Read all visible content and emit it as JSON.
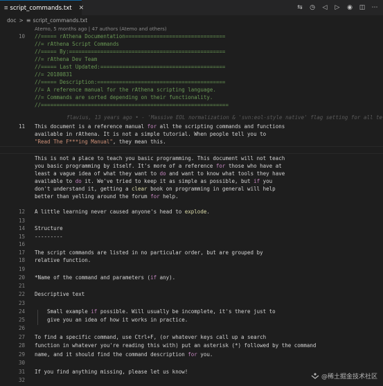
{
  "tab": {
    "icon": "list-lines-icon",
    "filename": "script_commands.txt"
  },
  "toolbar": {
    "icons": [
      "compare-changes-icon",
      "open-timeline-icon",
      "previous-change-icon",
      "next-change-icon",
      "circle-dot-icon",
      "split-editor-icon",
      "more-actions-icon"
    ]
  },
  "breadcrumb": {
    "folder": "doc",
    "separator": ">",
    "file_icon": "list-lines-icon",
    "file": "script_commands.txt"
  },
  "codelens": {
    "text": "Atemo, 5 months ago | 47 authors (Atemo and others)"
  },
  "inline_blame": {
    "text": "flavius, 13 years ago • - 'Massive EOL normalization & 'svn:eol-style native' flag setting for all te"
  },
  "lines": [
    {
      "n": "10",
      "segs": [
        {
          "t": "//===== rAthena Documentation================================",
          "c": "cmt"
        }
      ]
    },
    {
      "n": "",
      "segs": [
        {
          "t": "//= rAthena Script Commands",
          "c": "cmt"
        }
      ]
    },
    {
      "n": "",
      "segs": [
        {
          "t": "//===== By:==================================================",
          "c": "cmt"
        }
      ]
    },
    {
      "n": "",
      "segs": [
        {
          "t": "//= rAthena Dev Team",
          "c": "cmt"
        }
      ]
    },
    {
      "n": "",
      "segs": [
        {
          "t": "//===== Last Updated:========================================",
          "c": "cmt"
        }
      ]
    },
    {
      "n": "",
      "segs": [
        {
          "t": "//= 20180831",
          "c": "cmt"
        }
      ]
    },
    {
      "n": "",
      "segs": [
        {
          "t": "//===== Description:=========================================",
          "c": "cmt"
        }
      ]
    },
    {
      "n": "",
      "segs": [
        {
          "t": "//= A reference manual for the rAthena scripting language.",
          "c": "cmt"
        }
      ]
    },
    {
      "n": "",
      "segs": [
        {
          "t": "//= Commands are sorted depending on their functionality.",
          "c": "cmt"
        }
      ]
    },
    {
      "n": "",
      "segs": [
        {
          "t": "//============================================================",
          "c": "cmt"
        }
      ]
    },
    {
      "n": "",
      "blame": true,
      "segs": []
    },
    {
      "n": "11",
      "active": true,
      "segs": [
        {
          "t": "This document is a reference manual ",
          "c": ""
        },
        {
          "t": "for",
          "c": "ctl"
        },
        {
          "t": " all the scripting commands and functions",
          "c": ""
        }
      ]
    },
    {
      "n": "",
      "segs": [
        {
          "t": "available in rAthena. It is not a simple tutorial. When people tell you to",
          "c": ""
        }
      ]
    },
    {
      "n": "",
      "segs": [
        {
          "t": "\"Read The F***ing Manual\"",
          "c": "str"
        },
        {
          "t": ", they mean this.",
          "c": ""
        }
      ]
    },
    {
      "n": "",
      "segs": []
    },
    {
      "n": "",
      "segs": [
        {
          "t": "This is not a place to teach you basic programming. This document will not teach",
          "c": ""
        }
      ]
    },
    {
      "n": "",
      "segs": [
        {
          "t": "you basic programming by itself. It's more of a reference ",
          "c": ""
        },
        {
          "t": "for",
          "c": "ctl"
        },
        {
          "t": " those who have at",
          "c": ""
        }
      ]
    },
    {
      "n": "",
      "segs": [
        {
          "t": "least a vague idea of what they want to ",
          "c": ""
        },
        {
          "t": "do",
          "c": "ctl"
        },
        {
          "t": " and want to know what tools they have",
          "c": ""
        }
      ]
    },
    {
      "n": "",
      "segs": [
        {
          "t": "available to ",
          "c": ""
        },
        {
          "t": "do",
          "c": "ctl"
        },
        {
          "t": " it. We've tried to keep it as simple as possible, but ",
          "c": ""
        },
        {
          "t": "if",
          "c": "ctl"
        },
        {
          "t": " you",
          "c": ""
        }
      ]
    },
    {
      "n": "",
      "segs": [
        {
          "t": "don't understand it, getting a ",
          "c": ""
        },
        {
          "t": "clear",
          "c": "fn"
        },
        {
          "t": " book on programming in general will help",
          "c": ""
        }
      ]
    },
    {
      "n": "",
      "segs": [
        {
          "t": "better than yelling around the forum ",
          "c": ""
        },
        {
          "t": "for",
          "c": "ctl"
        },
        {
          "t": " help.",
          "c": ""
        }
      ]
    },
    {
      "n": "",
      "segs": []
    },
    {
      "n": "12",
      "segs": [
        {
          "t": "A little learning never caused anyone's head to ",
          "c": ""
        },
        {
          "t": "explode",
          "c": "fn"
        },
        {
          "t": ".",
          "c": ""
        }
      ]
    },
    {
      "n": "13",
      "segs": []
    },
    {
      "n": "14",
      "segs": [
        {
          "t": "Structure",
          "c": ""
        }
      ]
    },
    {
      "n": "15",
      "segs": [
        {
          "t": "---------",
          "c": ""
        }
      ]
    },
    {
      "n": "16",
      "segs": []
    },
    {
      "n": "17",
      "segs": [
        {
          "t": "The script commands are listed in no particular order, but are grouped by",
          "c": ""
        }
      ]
    },
    {
      "n": "18",
      "segs": [
        {
          "t": "relative function.",
          "c": ""
        }
      ]
    },
    {
      "n": "19",
      "segs": []
    },
    {
      "n": "20",
      "segs": [
        {
          "t": "*Name of the command and parameters (",
          "c": ""
        },
        {
          "t": "if",
          "c": "ctl"
        },
        {
          "t": " any).",
          "c": ""
        }
      ]
    },
    {
      "n": "21",
      "segs": []
    },
    {
      "n": "22",
      "segs": [
        {
          "t": "Descriptive text",
          "c": ""
        }
      ]
    },
    {
      "n": "23",
      "segs": []
    },
    {
      "n": "24",
      "segs": [
        {
          "t": "    Small example ",
          "c": ""
        },
        {
          "t": "if",
          "c": "ctl"
        },
        {
          "t": " possible. Will usually be incomplete, it's there just to",
          "c": ""
        }
      ]
    },
    {
      "n": "25",
      "segs": [
        {
          "t": "    give you an idea of how it works in practice.",
          "c": ""
        }
      ]
    },
    {
      "n": "26",
      "segs": []
    },
    {
      "n": "27",
      "segs": [
        {
          "t": "To find a specific command, use Ctrl+F, (or whatever keys call up a search",
          "c": ""
        }
      ]
    },
    {
      "n": "28",
      "segs": [
        {
          "t": "function in whatever you're reading this with) put an asterisk (*) followed by the command",
          "c": ""
        }
      ]
    },
    {
      "n": "29",
      "segs": [
        {
          "t": "name, and it should find the command description ",
          "c": ""
        },
        {
          "t": "for",
          "c": "ctl"
        },
        {
          "t": " you.",
          "c": ""
        }
      ]
    },
    {
      "n": "30",
      "segs": []
    },
    {
      "n": "31",
      "segs": [
        {
          "t": "If you find anything missing, please let us know!",
          "c": ""
        }
      ]
    },
    {
      "n": "32",
      "segs": []
    },
    {
      "n": "33",
      "segs": [
        {
          "t": "Syntax",
          "c": ""
        }
      ]
    }
  ],
  "watermark": {
    "logo": "xitu-logo",
    "text": "@稀土掘金技术社区"
  }
}
